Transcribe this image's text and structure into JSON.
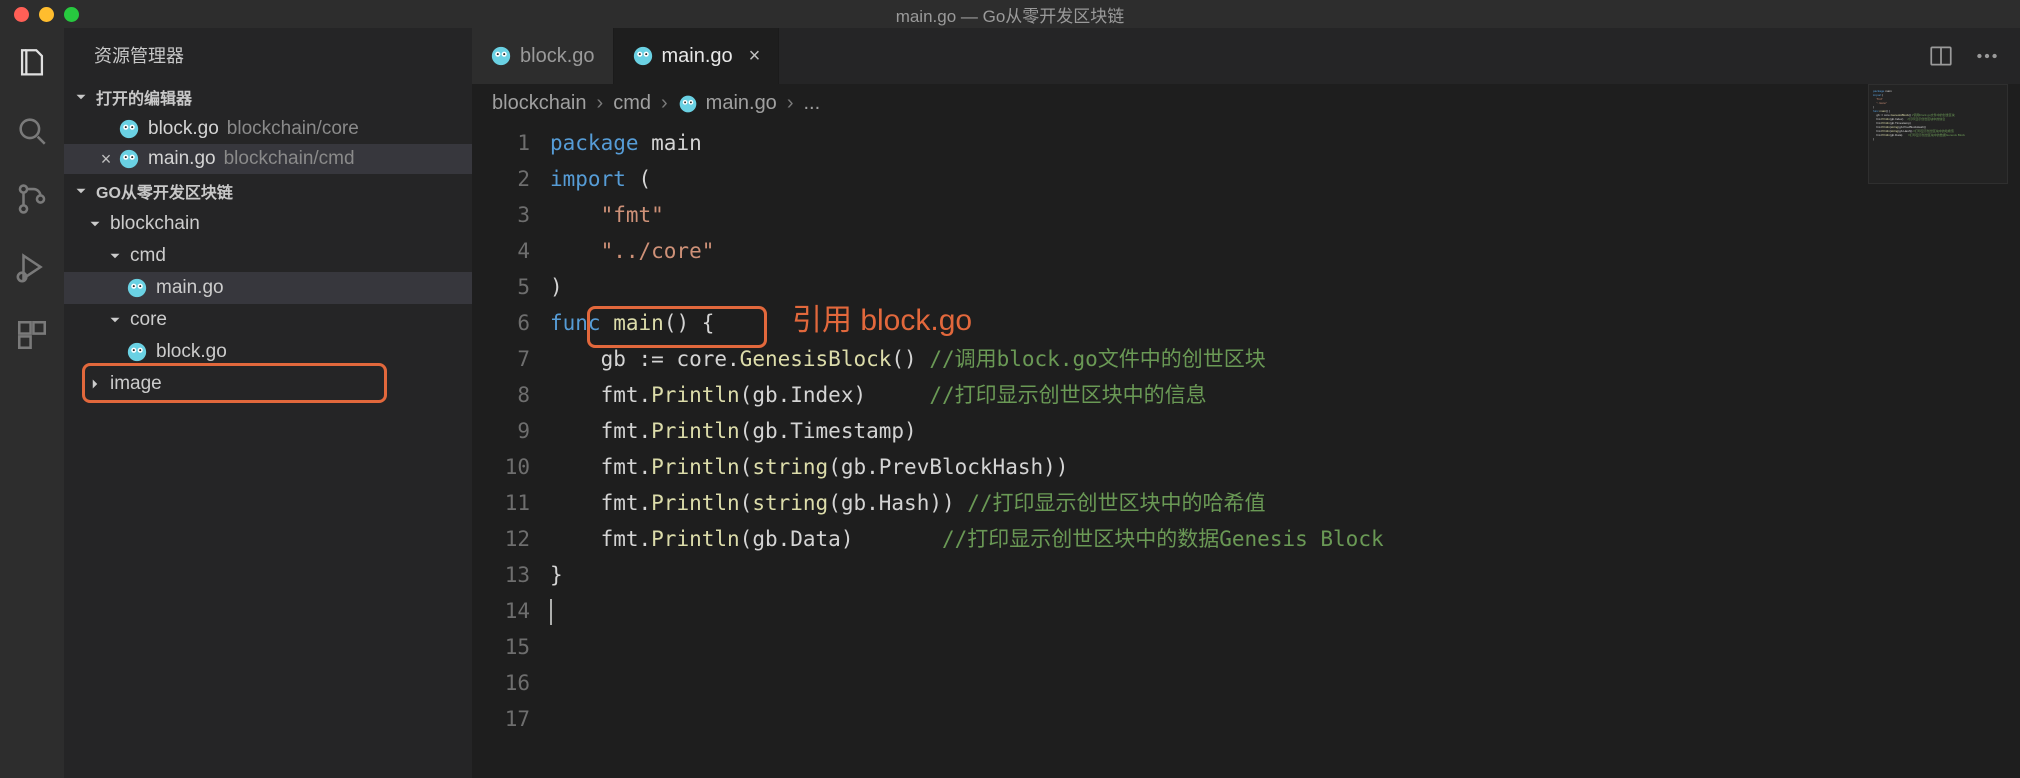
{
  "window_title": "main.go — Go从零开发区块链",
  "sidebar": {
    "title": "资源管理器",
    "open_editors_label": "打开的编辑器",
    "workspace_label": "GO从零开发区块链",
    "open_editors": [
      {
        "name": "block.go",
        "path": "blockchain/core",
        "active": false,
        "has_close": false
      },
      {
        "name": "main.go",
        "path": "blockchain/cmd",
        "active": true,
        "has_close": true
      }
    ],
    "tree": {
      "folder1": "blockchain",
      "folder2": "cmd",
      "file1": "main.go",
      "folder3": "core",
      "file2": "block.go",
      "folder4": "image"
    }
  },
  "tabs": [
    {
      "name": "block.go",
      "active": false
    },
    {
      "name": "main.go",
      "active": true
    }
  ],
  "breadcrumbs": {
    "seg1": "blockchain",
    "seg2": "cmd",
    "seg3": "main.go",
    "seg4": "..."
  },
  "annotation": {
    "text": "引用 block.go",
    "quoted_core": "\"../core\""
  },
  "code": {
    "lines": [
      [
        {
          "c": "tok-kw",
          "t": "package"
        },
        {
          "c": "tok-id",
          "t": " main"
        }
      ],
      [],
      [
        {
          "c": "tok-kw",
          "t": "import"
        },
        {
          "c": "tok-id",
          "t": " ("
        }
      ],
      [
        {
          "c": "tok-id",
          "t": "    "
        },
        {
          "c": "tok-str",
          "t": "\"fmt\""
        }
      ],
      [],
      [
        {
          "c": "tok-id",
          "t": "    "
        },
        {
          "c": "tok-str",
          "t": "\"../core\""
        }
      ],
      [
        {
          "c": "tok-id",
          "t": ")"
        }
      ],
      [],
      [
        {
          "c": "tok-kw",
          "t": "func"
        },
        {
          "c": "tok-id",
          "t": " "
        },
        {
          "c": "tok-fn",
          "t": "main"
        },
        {
          "c": "tok-id",
          "t": "() {"
        }
      ],
      [
        {
          "c": "tok-id",
          "t": "    gb "
        },
        {
          "c": "tok-op",
          "t": ":="
        },
        {
          "c": "tok-id",
          "t": " core."
        },
        {
          "c": "tok-fn",
          "t": "GenesisBlock"
        },
        {
          "c": "tok-id",
          "t": "() "
        },
        {
          "c": "tok-cm",
          "t": "//调用block.go文件中的创世区块"
        }
      ],
      [
        {
          "c": "tok-id",
          "t": "    fmt."
        },
        {
          "c": "tok-fn",
          "t": "Println"
        },
        {
          "c": "tok-id",
          "t": "(gb.Index)     "
        },
        {
          "c": "tok-cm",
          "t": "//打印显示创世区块中的信息"
        }
      ],
      [
        {
          "c": "tok-id",
          "t": "    fmt."
        },
        {
          "c": "tok-fn",
          "t": "Println"
        },
        {
          "c": "tok-id",
          "t": "(gb.Timestamp)"
        }
      ],
      [
        {
          "c": "tok-id",
          "t": "    fmt."
        },
        {
          "c": "tok-fn",
          "t": "Println"
        },
        {
          "c": "tok-id",
          "t": "("
        },
        {
          "c": "tok-fn",
          "t": "string"
        },
        {
          "c": "tok-id",
          "t": "(gb.PrevBlockHash))"
        }
      ],
      [
        {
          "c": "tok-id",
          "t": "    fmt."
        },
        {
          "c": "tok-fn",
          "t": "Println"
        },
        {
          "c": "tok-id",
          "t": "("
        },
        {
          "c": "tok-fn",
          "t": "string"
        },
        {
          "c": "tok-id",
          "t": "(gb.Hash)) "
        },
        {
          "c": "tok-cm",
          "t": "//打印显示创世区块中的哈希值"
        }
      ],
      [
        {
          "c": "tok-id",
          "t": "    fmt."
        },
        {
          "c": "tok-fn",
          "t": "Println"
        },
        {
          "c": "tok-id",
          "t": "(gb.Data)       "
        },
        {
          "c": "tok-cm",
          "t": "//打印显示创世区块中的数据Genesis Block"
        }
      ],
      [
        {
          "c": "tok-id",
          "t": "}"
        }
      ],
      []
    ],
    "line_numbers": [
      "1",
      "2",
      "3",
      "4",
      "5",
      "6",
      "7",
      "8",
      "9",
      "10",
      "11",
      "12",
      "13",
      "14",
      "15",
      "16",
      "17"
    ]
  },
  "icon_names": {
    "files": "files-icon",
    "search": "search-icon",
    "scm": "source-control-icon",
    "debug": "debug-icon",
    "extensions": "extensions-icon",
    "split": "split-editor-icon",
    "more": "more-icon"
  }
}
